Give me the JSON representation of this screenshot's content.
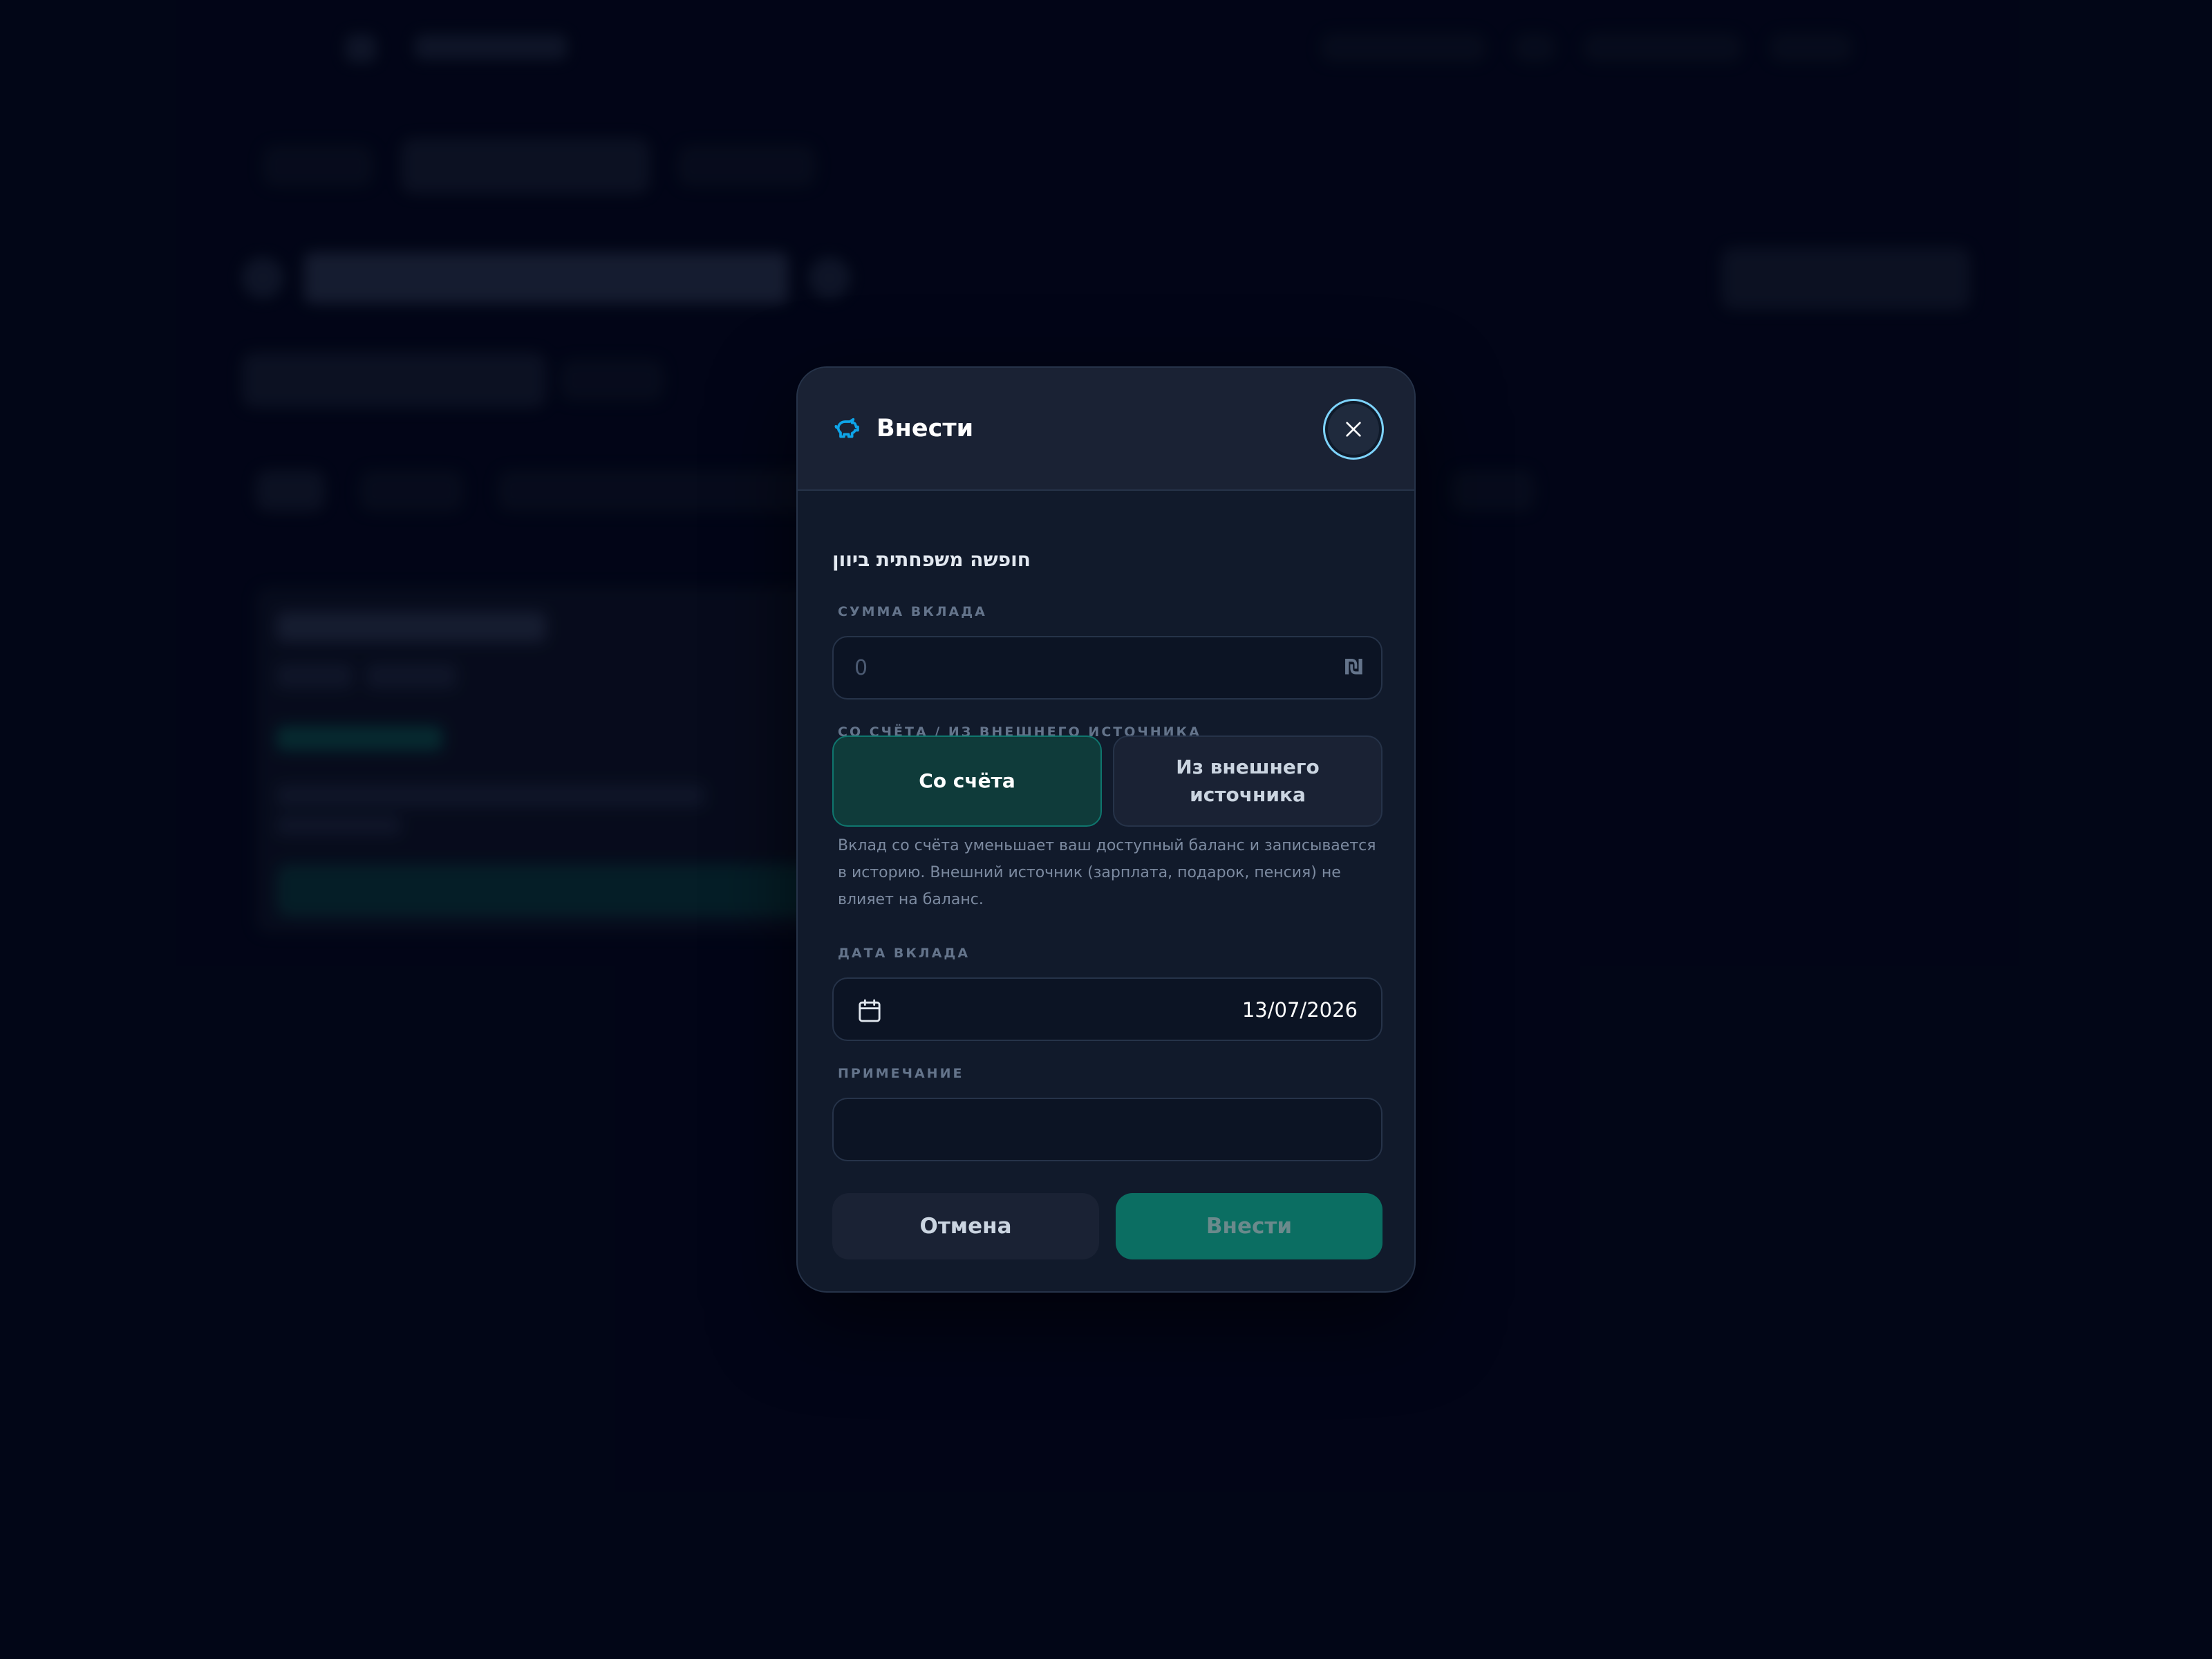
{
  "modal": {
    "title": "Внести",
    "goal_name": "חופשה משפחתית ביוון",
    "amount": {
      "label": "СУММА ВКЛАДА",
      "placeholder": "0",
      "currency": "₪"
    },
    "source": {
      "label": "СО СЧЁТА / ИЗ ВНЕШНЕГО ИСТОЧНИКА",
      "options": [
        {
          "label": "Со счёта",
          "selected": true
        },
        {
          "label": "Из внешнего источника",
          "selected": false
        }
      ],
      "hint": "Вклад со счёта уменьшает ваш доступный баланс и записывается в историю. Внешний источник (зарплата, подарок, пенсия) не влияет на баланс."
    },
    "date": {
      "label": "ДАТА ВКЛАДА",
      "value": "13/07/2026"
    },
    "note": {
      "label": "ПРИМЕЧАНИЕ",
      "value": ""
    },
    "buttons": {
      "cancel": "Отмена",
      "submit": "Внести"
    }
  },
  "colors": {
    "accent_teal": "#0b6e62",
    "accent_sky": "#0ea5e9",
    "background": "#020617"
  }
}
